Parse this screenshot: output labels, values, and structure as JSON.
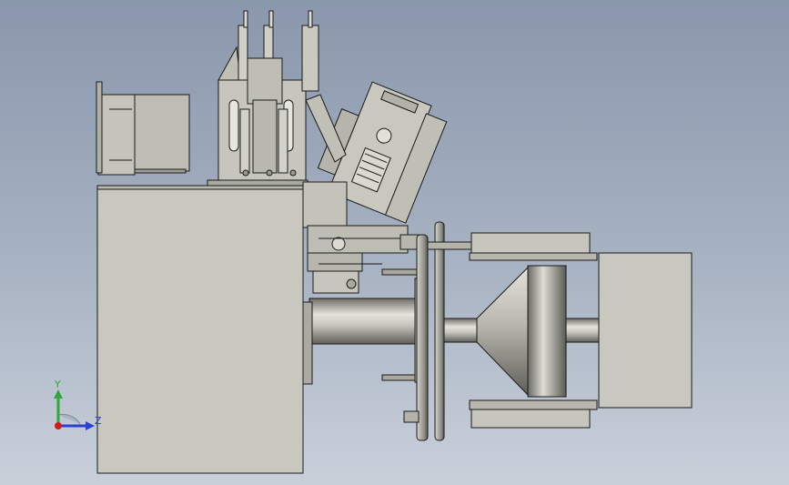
{
  "view": {
    "type": "cad-model-viewport",
    "background_top": "#8a97ac",
    "background_bottom": "#c9d0da",
    "part_fill": "#c8c8be",
    "part_shadow": "#8e8e86",
    "edge_color": "#1a1a1a"
  },
  "triad": {
    "y_label": "Y",
    "z_label": "Z",
    "y_color": "#2fa83a",
    "z_color": "#2b3fd6",
    "origin_color": "#d01b1b"
  }
}
